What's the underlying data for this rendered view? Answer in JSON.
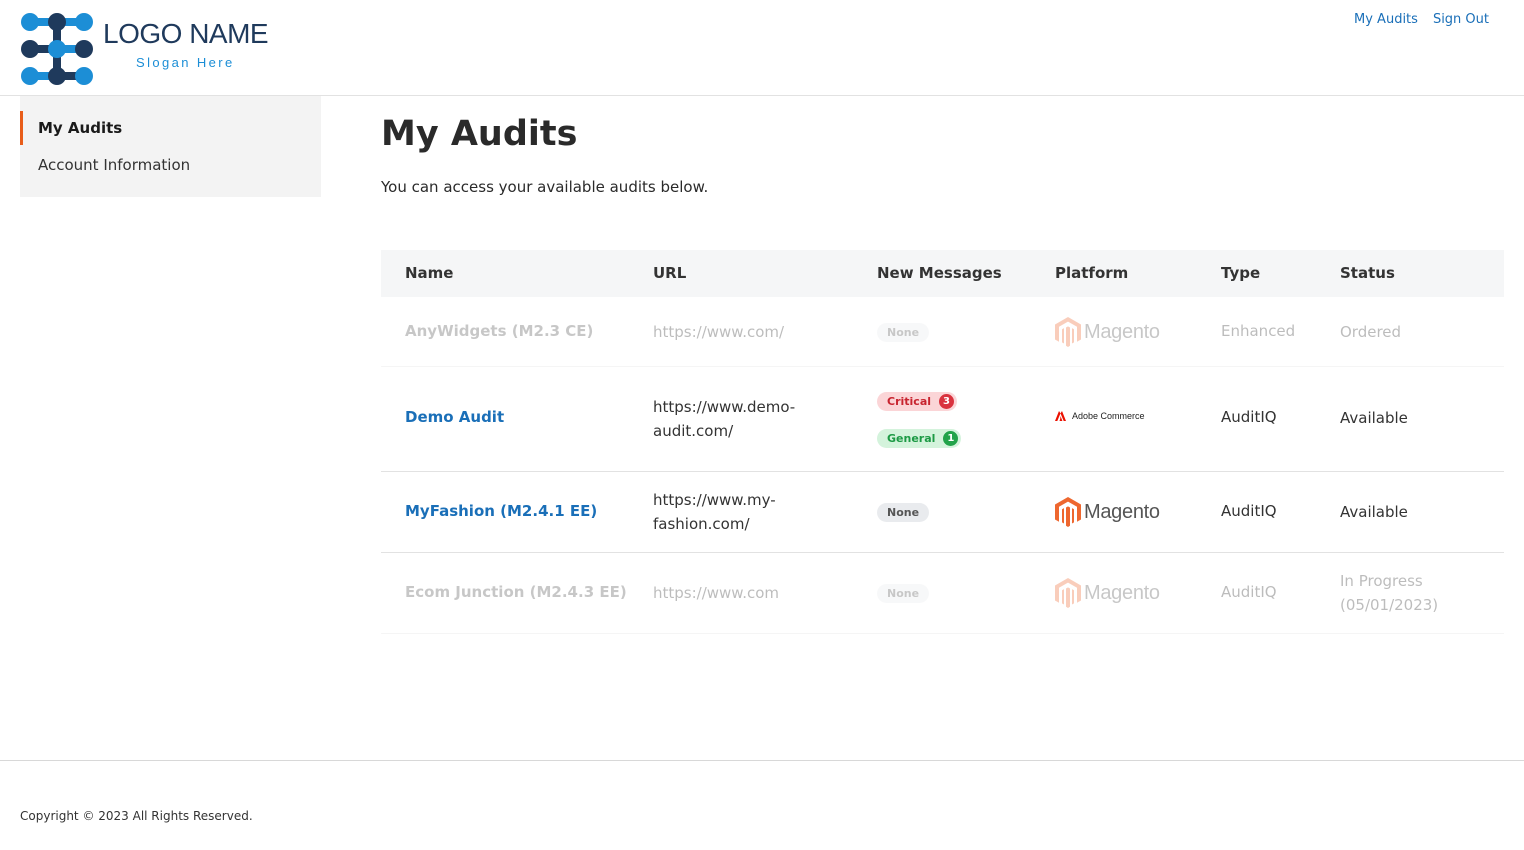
{
  "header": {
    "logo_name": "LOGO NAME",
    "slogan": "Slogan Here",
    "nav": [
      "My Audits",
      "Sign Out"
    ]
  },
  "sidebar": {
    "items": [
      {
        "label": "My Audits",
        "active": true
      },
      {
        "label": "Account Information",
        "active": false
      }
    ]
  },
  "main": {
    "title": "My Audits",
    "subtitle": "You can access your available audits below."
  },
  "table": {
    "columns": [
      "Name",
      "URL",
      "New Messages",
      "Platform",
      "Type",
      "Status"
    ],
    "rows": [
      {
        "name": "AnyWidgets (M2.3 CE)",
        "url": "https://www.com/",
        "messages": "None",
        "platform": "Magento",
        "type": "Enhanced",
        "status": "Ordered",
        "enabled": false
      },
      {
        "name": "Demo Audit",
        "url": "https://www.demo-audit.com/",
        "critical_label": "Critical",
        "critical_count": "3",
        "general_label": "General",
        "general_count": "1",
        "platform": "Adobe Commerce",
        "type": "AuditIQ",
        "status": "Available",
        "enabled": true
      },
      {
        "name": "MyFashion (M2.4.1 EE)",
        "url": "https://www.my-fashion.com/",
        "messages": "None",
        "platform": "Magento",
        "type": "AuditIQ",
        "status": "Available",
        "enabled": true
      },
      {
        "name": "Ecom Junction (M2.4.3 EE)",
        "url": "https://www.com",
        "messages": "None",
        "platform": "Magento",
        "type": "AuditIQ",
        "status": "In Progress (05/01/2023)",
        "enabled": false
      }
    ]
  },
  "footer": {
    "copyright": "Copyright © 2023 All Rights Reserved."
  },
  "colors": {
    "link": "#1a6fb8",
    "accent": "#e85d1a",
    "magento": "#ee672f",
    "adobe": "#eb1000",
    "logo_dark": "#1f3a5c",
    "logo_light": "#1c8ed6"
  }
}
